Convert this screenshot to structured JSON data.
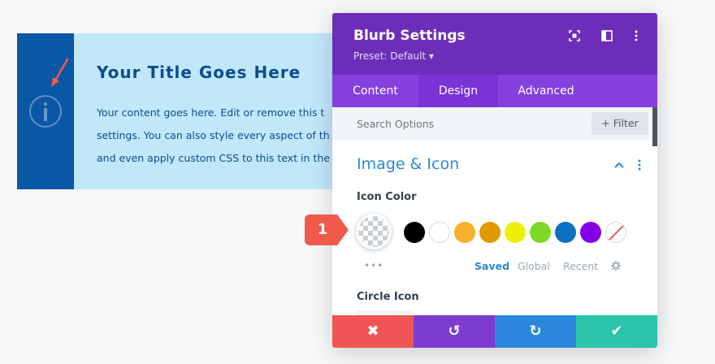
{
  "blurb": {
    "title": "Your Title Goes Here",
    "lines": [
      "Your content goes here. Edit or remove this t",
      "settings. You can also style every aspect of th",
      "and even apply custom CSS to this text in the"
    ],
    "icon": "info-circle-icon"
  },
  "panel": {
    "title": "Blurb Settings",
    "preset": "Preset: Default ▾",
    "header_icons": [
      "fullscreen-icon",
      "split-view-icon",
      "more-vertical-icon"
    ],
    "tabs": [
      {
        "label": "Content"
      },
      {
        "label": "Design"
      },
      {
        "label": "Advanced"
      }
    ],
    "active_tab": "Design",
    "search": {
      "placeholder": "Search Options"
    },
    "filter_label": "+ Filter",
    "section_title": "Image & Icon",
    "icon_color_label": "Icon Color",
    "swatches": [
      "#000000",
      "#ffffff",
      "#f5b02c",
      "#e09900",
      "#edf000",
      "#7cda24",
      "#0c71c3",
      "#8300e9"
    ],
    "more_colors": "•••",
    "palette_tabs": [
      "Saved",
      "Global",
      "Recent"
    ],
    "active_palette": "Saved",
    "circle_icon_label": "Circle Icon",
    "footer": [
      {
        "icon": "close-icon",
        "glyph": "✖",
        "color": "#ef5555"
      },
      {
        "icon": "undo-icon",
        "glyph": "↺",
        "color": "#7e3bd0"
      },
      {
        "icon": "redo-icon",
        "glyph": "↻",
        "color": "#2b87da"
      },
      {
        "icon": "check-icon",
        "glyph": "✔",
        "color": "#29c4a9"
      }
    ]
  },
  "badge": {
    "label": "1",
    "color": "#ef5a4b"
  },
  "colors": {
    "header": "#6c2eb9",
    "tabs": "#8540dd",
    "accent": "#2b87da",
    "blurb_bg": "#c1e7fa",
    "blurb_side": "#0a57a6"
  }
}
